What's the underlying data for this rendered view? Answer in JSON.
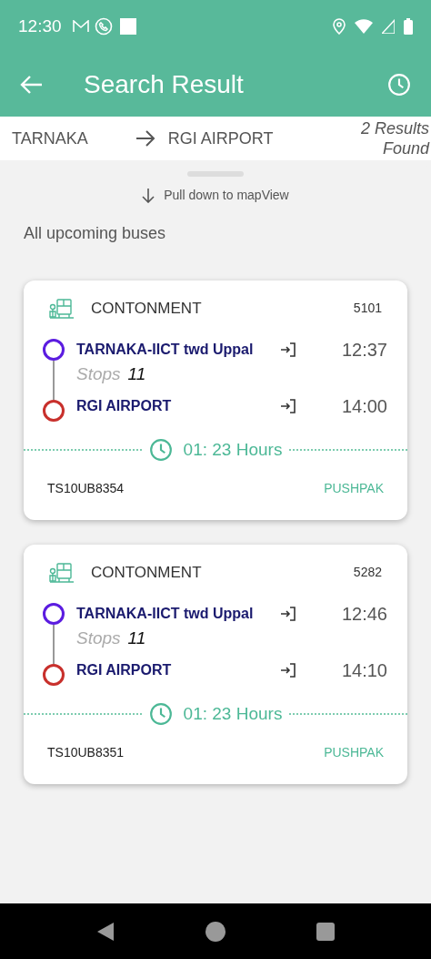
{
  "status_bar": {
    "time": "12:30"
  },
  "app_bar": {
    "title": "Search Result"
  },
  "route": {
    "from": "TARNAKA",
    "to": "RGI AIRPORT",
    "results": "2 Results Found"
  },
  "sheet": {
    "hint": "Pull down to mapView",
    "heading": "All upcoming buses"
  },
  "buses": [
    {
      "depot": "CONTONMENT",
      "route_no": "5101",
      "from": "TARNAKA-IICT twd Uppal",
      "depart": "12:37",
      "stops_label": "Stops",
      "stops": "11",
      "to": "RGI AIRPORT",
      "arrive": "14:00",
      "duration": "01: 23 Hours",
      "vehicle": "TS10UB8354",
      "service": "PUSHPAK"
    },
    {
      "depot": "CONTONMENT",
      "route_no": "5282",
      "from": "TARNAKA-IICT twd Uppal",
      "depart": "12:46",
      "stops_label": "Stops",
      "stops": "11",
      "to": "RGI AIRPORT",
      "arrive": "14:10",
      "duration": "01: 23 Hours",
      "vehicle": "TS10UB8351",
      "service": "PUSHPAK"
    }
  ]
}
